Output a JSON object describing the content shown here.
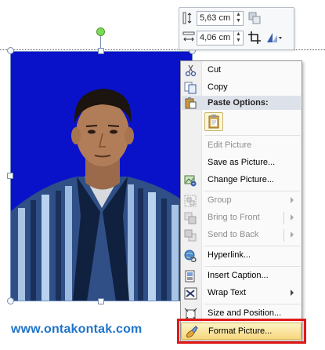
{
  "mini_toolbar": {
    "height_value": "5,63 cm",
    "width_value": "4,06 cm",
    "height_icon": "shape-height-icon",
    "width_icon": "shape-width-icon",
    "bring_forward_icon": "bring-forward-icon",
    "send_backward_icon": "send-backward-icon",
    "crop_icon": "crop-icon",
    "styles_icon": "picture-styles-icon"
  },
  "context_menu": {
    "cut": "Cut",
    "copy": "Copy",
    "paste_options": "Paste Options:",
    "edit_picture": "Edit Picture",
    "save_as_picture": "Save as Picture...",
    "change_picture": "Change Picture...",
    "group": "Group",
    "bring_to_front": "Bring to Front",
    "send_to_back": "Send to Back",
    "hyperlink": "Hyperlink...",
    "insert_caption": "Insert Caption...",
    "wrap_text": "Wrap Text",
    "size_and_position": "Size and Position...",
    "format_picture": "Format Picture..."
  },
  "watermark": "www.ontakontak.com",
  "colors": {
    "photo_background": "#0a12c9",
    "highlight_outline": "#e21919",
    "watermark": "#1f74c9"
  }
}
